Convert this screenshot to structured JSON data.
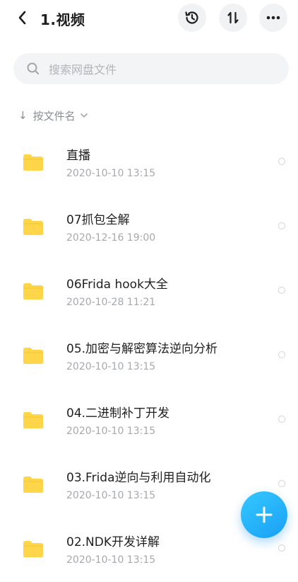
{
  "header": {
    "title": "1.视频",
    "back_icon": "chevron-left-icon",
    "history_icon": "history-icon",
    "sort_icon": "sort-icon",
    "more_icon": "more-icon"
  },
  "search": {
    "placeholder": "搜索网盘文件",
    "icon": "search-icon"
  },
  "sort": {
    "arrow": "↓",
    "label": "按文件名"
  },
  "files": [
    {
      "name": "直播",
      "date": "2020-10-10  13:15"
    },
    {
      "name": "07抓包全解",
      "date": "2020-12-16  19:00"
    },
    {
      "name": "06Frida hook大全",
      "date": "2020-10-28  11:21"
    },
    {
      "name": "05.加密与解密算法逆向分析",
      "date": "2020-10-10  13:15"
    },
    {
      "name": "04.二进制补丁开发",
      "date": "2020-10-10  13:15"
    },
    {
      "name": "03.Frida逆向与利用自动化",
      "date": "2020-10-10  13:15"
    },
    {
      "name": "02.NDK开发详解",
      "date": "2020-10-10  13:15"
    }
  ],
  "fab": {
    "icon": "plus-icon"
  },
  "colors": {
    "folder": "#ffd54a",
    "accent": "#22adf7",
    "secondary_text": "#a7a9ad"
  }
}
